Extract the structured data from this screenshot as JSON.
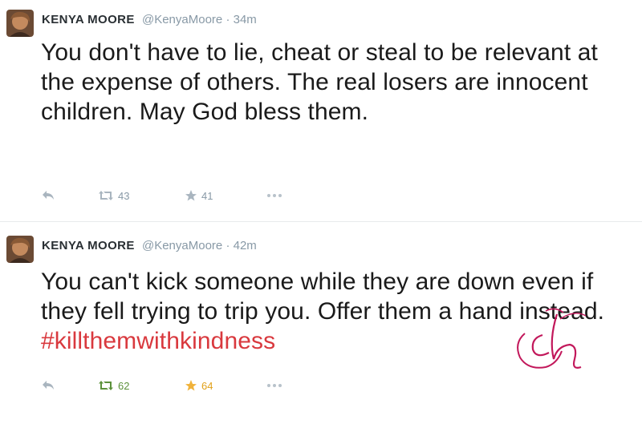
{
  "tweets": [
    {
      "name": "KENYA MOORE",
      "handle": "@KenyaMoore",
      "separator": "·",
      "time": "34m",
      "text": "You don't have to lie, cheat or steal to be relevant at the expense of others. The real losers are innocent children. May God bless them.",
      "hashtag": "",
      "retweets": "43",
      "favorites": "41",
      "retweeted": false,
      "favorited": false
    },
    {
      "name": "KENYA MOORE",
      "handle": "@KenyaMoore",
      "separator": "·",
      "time": "42m",
      "text": "You can't kick someone while they are down even if they fell trying to trip you. Offer them a hand instead. ",
      "hashtag": "#killthemwithkindness",
      "retweets": "62",
      "favorites": "64",
      "retweeted": true,
      "favorited": true
    }
  ],
  "icons": {
    "reply": "reply-icon",
    "retweet": "retweet-icon",
    "favorite": "star-icon",
    "more": "more-dots-icon"
  },
  "colors": {
    "hashtag": "#d9393e",
    "retweeted": "#5c913b",
    "favorited": "#e1a11b",
    "muted": "#8899a6",
    "watermark": "#c2185b"
  }
}
